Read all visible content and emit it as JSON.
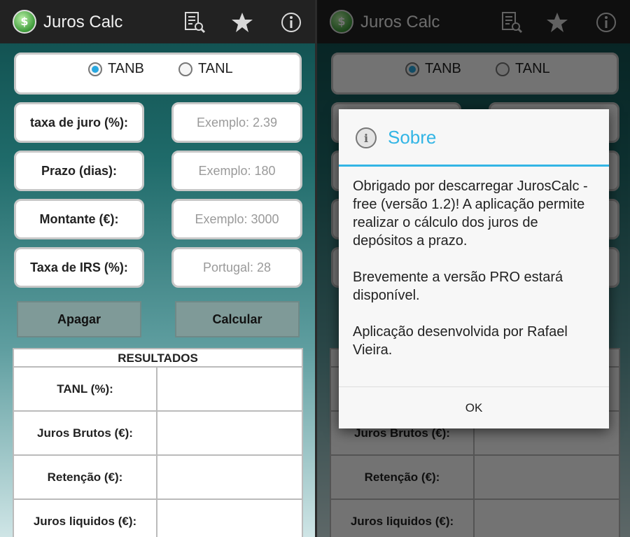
{
  "app": {
    "title": "Juros Calc"
  },
  "actions": [
    {
      "icon": "search-list-icon"
    },
    {
      "icon": "star-icon"
    },
    {
      "icon": "info-icon"
    }
  ],
  "rate_type": {
    "options": [
      {
        "label": "TANB",
        "selected": true
      },
      {
        "label": "TANL",
        "selected": false
      }
    ]
  },
  "form": {
    "fields": [
      {
        "label": "taxa de juro (%):",
        "placeholder": "Exemplo: 2.39"
      },
      {
        "label": "Prazo (dias):",
        "placeholder": "Exemplo: 180"
      },
      {
        "label": "Montante (€):",
        "placeholder": "Exemplo: 3000"
      },
      {
        "label": "Taxa de IRS (%):",
        "placeholder": "Portugal: 28"
      }
    ],
    "clear_label": "Apagar",
    "calc_label": "Calcular"
  },
  "results": {
    "title": "RESULTADOS",
    "rows": [
      {
        "label": "TANL (%):",
        "value": ""
      },
      {
        "label": "Juros Brutos (€):",
        "value": ""
      },
      {
        "label": "Retenção (€):",
        "value": ""
      },
      {
        "label": "Juros liquidos (€):",
        "value": ""
      }
    ]
  },
  "dialog": {
    "title": "Sobre",
    "paragraphs": [
      "Obrigado por descarregar JurosCalc - free (versão 1.2)! A aplicação permite realizar o cálculo dos juros de depósitos a prazo.",
      "Brevemente a versão PRO estará disponível.",
      "Aplicação desenvolvida por Rafael Vieira."
    ],
    "ok_label": "OK"
  },
  "colors": {
    "accent": "#33b5e5",
    "actionbar": "#222222",
    "button": "#7f9a98"
  }
}
